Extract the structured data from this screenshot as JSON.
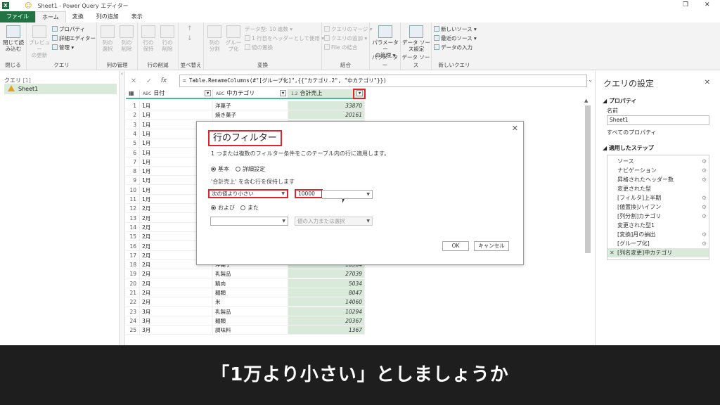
{
  "window": {
    "title": "Sheet1 - Power Query エディター"
  },
  "ribbon_tabs": [
    "ファイル",
    "ホーム",
    "変換",
    "列の追加",
    "表示"
  ],
  "ribbon": {
    "close_load": "閉じて読\nみ込む",
    "close_group": "閉じる",
    "preview_refresh": "プレビュー\nの更新",
    "properties": "プロパティ",
    "advanced_editor": "詳細エディター",
    "manage": "管理",
    "query_group": "クエリ",
    "choose_cols": "列の\n選択",
    "remove_cols": "列の\n削除",
    "column_mgmt_group": "列の管理",
    "keep_rows": "行の\n保持",
    "remove_rows": "行の\n削除",
    "reduce_rows_group": "行の削減",
    "sort_group": "並べ替え",
    "split_col": "列の\n分割",
    "group_by": "グルー\nプ化",
    "datatype": "データ型: 10 進数",
    "first_row_header": "1 行目をヘッダーとして使用",
    "replace_values": "値の置換",
    "transform_group": "変換",
    "merge_queries": "クエリのマージ",
    "append_queries": "クエリの追加",
    "combine_files": "File の結合",
    "combine_group": "結合",
    "manage_params": "パラメーター\nの管理",
    "params_group": "パラメーター",
    "datasource_settings": "データ ソー\nス設定",
    "datasource_group": "データ ソース",
    "new_source": "新しいソース",
    "recent_sources": "最近のソース",
    "enter_data": "データの入力",
    "new_query_group": "新しいクエリ"
  },
  "queries": {
    "header": "クエリ",
    "count": "[1]",
    "items": [
      "Sheet1"
    ]
  },
  "formula": {
    "text": "= Table.RenameColumns(#\"[グループ化]\",{{\"カテゴリ.2\", \"中カテゴリ\"}})"
  },
  "grid": {
    "columns": [
      {
        "type": "ABC",
        "name": "日付"
      },
      {
        "type": "ABC",
        "name": "中カテゴリ"
      },
      {
        "type": "1.2",
        "name": "合計売上"
      }
    ],
    "rows": [
      [
        "1",
        "1月",
        "洋菓子",
        "33870"
      ],
      [
        "2",
        "1月",
        "焼き菓子",
        "20161"
      ],
      [
        "3",
        "1月",
        "",
        ""
      ],
      [
        "4",
        "1月",
        "",
        ""
      ],
      [
        "5",
        "1月",
        "",
        ""
      ],
      [
        "6",
        "1月",
        "",
        ""
      ],
      [
        "7",
        "1月",
        "",
        ""
      ],
      [
        "8",
        "1月",
        "",
        ""
      ],
      [
        "9",
        "1月",
        "",
        ""
      ],
      [
        "10",
        "1月",
        "",
        ""
      ],
      [
        "11",
        "1月",
        "",
        ""
      ],
      [
        "12",
        "2月",
        "",
        ""
      ],
      [
        "13",
        "2月",
        "",
        ""
      ],
      [
        "14",
        "2月",
        "",
        ""
      ],
      [
        "15",
        "2月",
        "",
        ""
      ],
      [
        "16",
        "2月",
        "",
        ""
      ],
      [
        "17",
        "2月",
        "",
        ""
      ],
      [
        "18",
        "2月",
        "洋菓子",
        "18564"
      ],
      [
        "19",
        "2月",
        "乳製品",
        "27039"
      ],
      [
        "20",
        "2月",
        "精肉",
        "5034"
      ],
      [
        "21",
        "2月",
        "麺類",
        "8047"
      ],
      [
        "22",
        "2月",
        "米",
        "14060"
      ],
      [
        "23",
        "3月",
        "乳製品",
        "10294"
      ],
      [
        "24",
        "3月",
        "麺類",
        "20367"
      ],
      [
        "25",
        "3月",
        "調味料",
        "1367"
      ]
    ]
  },
  "settings": {
    "title": "クエリの設定",
    "properties_header": "プロパティ",
    "name_label": "名前",
    "name_value": "Sheet1",
    "all_properties": "すべてのプロパティ",
    "steps_header": "適用したステップ",
    "steps": [
      {
        "label": "ソース",
        "gear": true
      },
      {
        "label": "ナビゲーション",
        "gear": true
      },
      {
        "label": "昇格されたヘッダー数",
        "gear": true
      },
      {
        "label": "変更された型",
        "gear": false
      },
      {
        "label": "[フィルタ]上半期",
        "gear": true
      },
      {
        "label": "[値置換]ハイフン",
        "gear": true
      },
      {
        "label": "[列分割]カテゴリ",
        "gear": true
      },
      {
        "label": "変更された型1",
        "gear": false
      },
      {
        "label": "[変換]月の抽出",
        "gear": true
      },
      {
        "label": "[グループ化]",
        "gear": true
      },
      {
        "label": "[列名変更]中カテゴリ",
        "gear": false
      }
    ]
  },
  "dialog": {
    "title": "行のフィルター",
    "description": "1 つまたは複数のフィルター条件をこのテーブル内の行に適用します。",
    "mode_basic": "基本",
    "mode_advanced": "詳細設定",
    "keep_text": "'合計売上' を含む行を保持します",
    "operator1": "次の値より小さい",
    "value1": "10000",
    "and_label": "および",
    "or_label": "また",
    "operator2": "",
    "value2_placeholder": "値の入力または選択",
    "ok": "OK",
    "cancel": "キャンセル"
  },
  "caption": "「1万より小さい」としましょうか",
  "colors": {
    "excel_green": "#217346",
    "selection_green": "#d9eadb",
    "highlight_red": "#e0242e",
    "caption_bg": "#1e1e1e"
  }
}
